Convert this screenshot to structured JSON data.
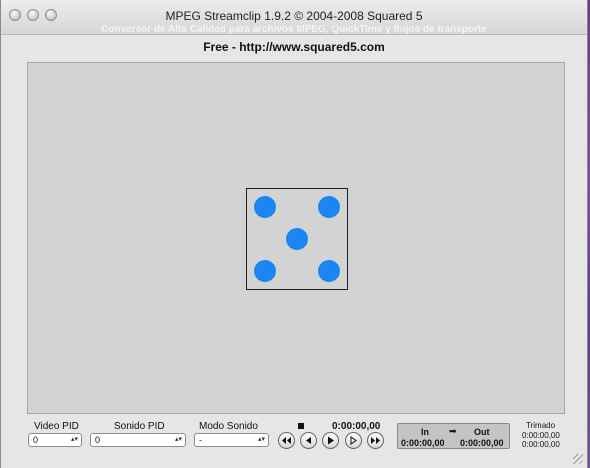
{
  "window": {
    "title": "MPEG Streamclip 1.9.2 © 2004-2008 Squared 5",
    "subtitle": "Conversor de Alta Calidad para archivos MPEG, QuickTime y flujos de transporte",
    "info": "Free  -  http://www.squared5.com"
  },
  "controls": {
    "video_pid": {
      "label": "Video PID",
      "value": "0"
    },
    "audio_pid": {
      "label": "Sonido PID",
      "value": "0"
    },
    "audio_mode": {
      "label": "Modo Sonido",
      "value": "-"
    }
  },
  "transport": {
    "time": "0:00:00,00",
    "buttons": [
      "rewind-icon",
      "step-back-icon",
      "play-icon",
      "step-forward-icon",
      "fast-forward-icon"
    ]
  },
  "inout": {
    "in_label": "In",
    "out_label": "Out",
    "arrow": "➡",
    "in_time": "0:00:00,00",
    "out_time": "0:00:00,00"
  },
  "trim": {
    "label": "Trimado",
    "time1": "0:00:00,00",
    "time2": "0:00:00,00"
  },
  "colors": {
    "pip": "#1a86f2",
    "viewer_bg": "#d3d3d3"
  }
}
